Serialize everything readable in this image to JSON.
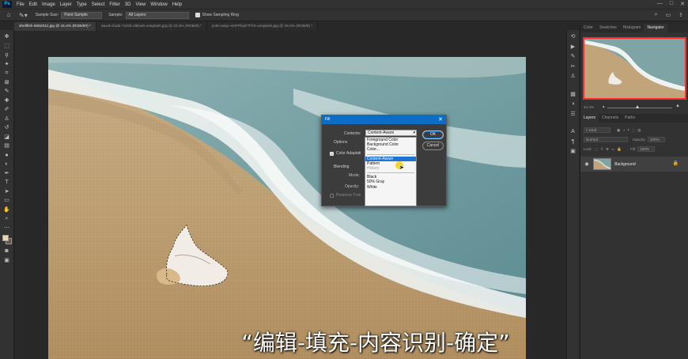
{
  "app": {
    "logo": "Ps"
  },
  "menu": [
    "File",
    "Edit",
    "Image",
    "Layer",
    "Type",
    "Select",
    "Filter",
    "3D",
    "View",
    "Window",
    "Help"
  ],
  "window_controls": {
    "minimize": "—",
    "maximize": "□",
    "close": "✕"
  },
  "options_bar": {
    "sample_size_label": "Sample Size:",
    "sample_size_value": "Point Sample",
    "sample_label": "Sample:",
    "sample_value": "All Layers",
    "show_ring_label": "Show Sampling Ring"
  },
  "tabs": [
    {
      "label": "shellfish-5062011.jpg @ 44.4% (RGB/8#) *",
      "active": true
    },
    {
      "label": "david-clode-7Utzb-z9ibw0-unsplash.jpg @ 33.3% (RGB/8) *",
      "active": false
    },
    {
      "label": "jcob-nasyr-eGFPbqF7Fh0-unsplash.jpg @ 39.3% (RGB/8) *",
      "active": false
    }
  ],
  "fill_dialog": {
    "title": "Fill",
    "contents_label": "Contents:",
    "contents_value": "Content-Aware",
    "ok_label": "OK",
    "cancel_label": "Cancel",
    "options_label": "Options",
    "color_adaptation_label": "Color Adaptati",
    "blending_label": "Blending",
    "mode_label": "Mode:",
    "opacity_label": "Opacity:",
    "preserve_label": "Preserve Tran",
    "dropdown": {
      "group1": [
        "Foreground Color",
        "Background Color",
        "Color..."
      ],
      "group2": [
        "Content-Aware",
        "Pattern",
        "History"
      ],
      "group3": [
        "Black",
        "50% Gray",
        "White"
      ],
      "selected": "Content-Aware",
      "disabled": "History"
    }
  },
  "caption": "“编辑-填充-内容识别-确定”",
  "panels": {
    "top_tabs": [
      "Color",
      "Swatches",
      "Histogram",
      "Navigator"
    ],
    "active_top_tab": "Navigator",
    "zoom": "44.4%",
    "layer_tabs": [
      "Layers",
      "Channels",
      "Paths"
    ],
    "active_layer_tab": "Layers",
    "kind_label": "Kind",
    "blend_mode": "Normal",
    "opacity_label": "Opacity:",
    "opacity_value": "100%",
    "lock_label": "Lock:",
    "fill_label": "Fill:",
    "fill_value": "100%",
    "layer_name": "Background"
  },
  "colors": {
    "accent": "#0d6cc6",
    "nav_box": "#ff2b2b",
    "panel_bg": "#323232"
  }
}
